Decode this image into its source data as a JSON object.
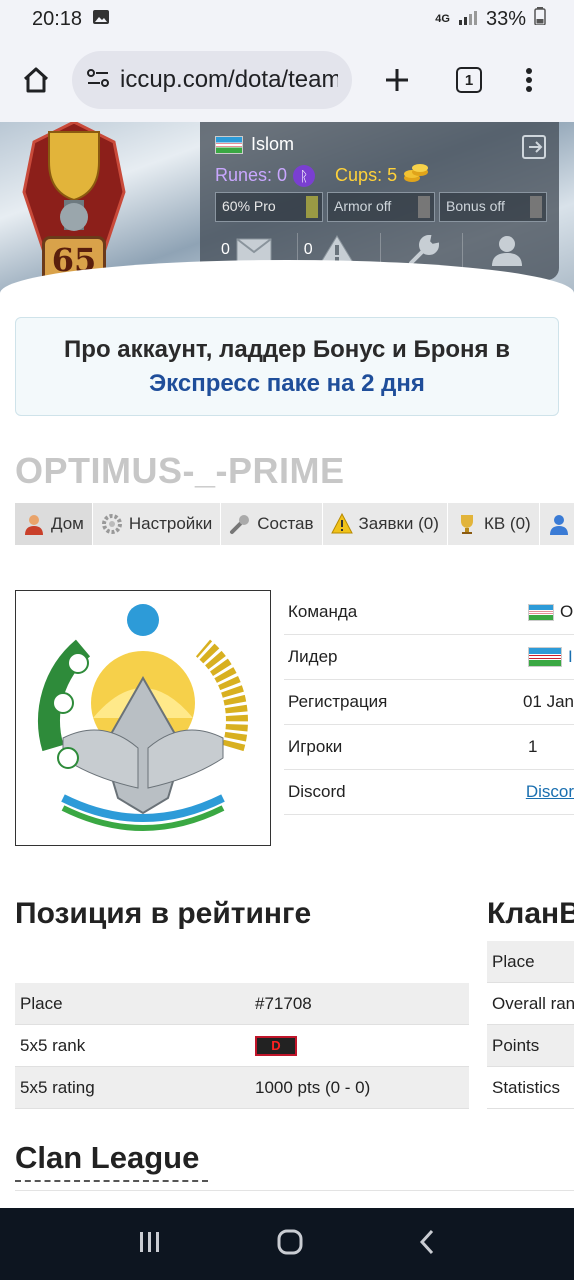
{
  "status_bar": {
    "time": "20:18",
    "network": "4G",
    "battery": "33%"
  },
  "browser": {
    "url": "iccup.com/dota/team",
    "tab_count": "1"
  },
  "user_panel": {
    "username": "Islom",
    "runes_label": "Runes: 0",
    "cups_label": "Cups: 5",
    "slots": [
      "60% Pro",
      "Armor off",
      "Bonus off"
    ],
    "messages_count": "0",
    "alerts_count": "0"
  },
  "level": "65",
  "promo": {
    "line1": "Про аккаунт, ладдер Бонус и Броня в",
    "line2": "Экспресс паке на 2 дня"
  },
  "team": {
    "name": "OPTIMUS-_-PRIME",
    "tabs": [
      "Дом",
      "Настройки",
      "Состав",
      "Заявки (0)",
      "КВ (0)"
    ],
    "info": [
      {
        "label": "Команда",
        "value": "O"
      },
      {
        "label": "Лидер",
        "value": "I"
      },
      {
        "label": "Регистрация",
        "value": "01 Jan"
      },
      {
        "label": "Игроки",
        "value": "1"
      },
      {
        "label": "Discord",
        "value": "Discor"
      }
    ]
  },
  "ranking": {
    "title": "Позиция в рейтинге",
    "rows": [
      {
        "label": "Place",
        "value": "#71708"
      },
      {
        "label": "5x5 rank",
        "value": "D"
      },
      {
        "label": "5x5 rating",
        "value": "1000 pts (0 - 0)"
      }
    ]
  },
  "clan_war": {
    "title": "КланВ",
    "rows": [
      "Place",
      "Overall ran",
      "Points",
      "Statistics"
    ]
  },
  "clan_league": {
    "title": "Clan League"
  },
  "colors": {
    "link": "#1a6fb0",
    "promo_accent": "#1f4e9a",
    "team_title": "#c7c7c7",
    "rank_badge": "#c0152a"
  }
}
